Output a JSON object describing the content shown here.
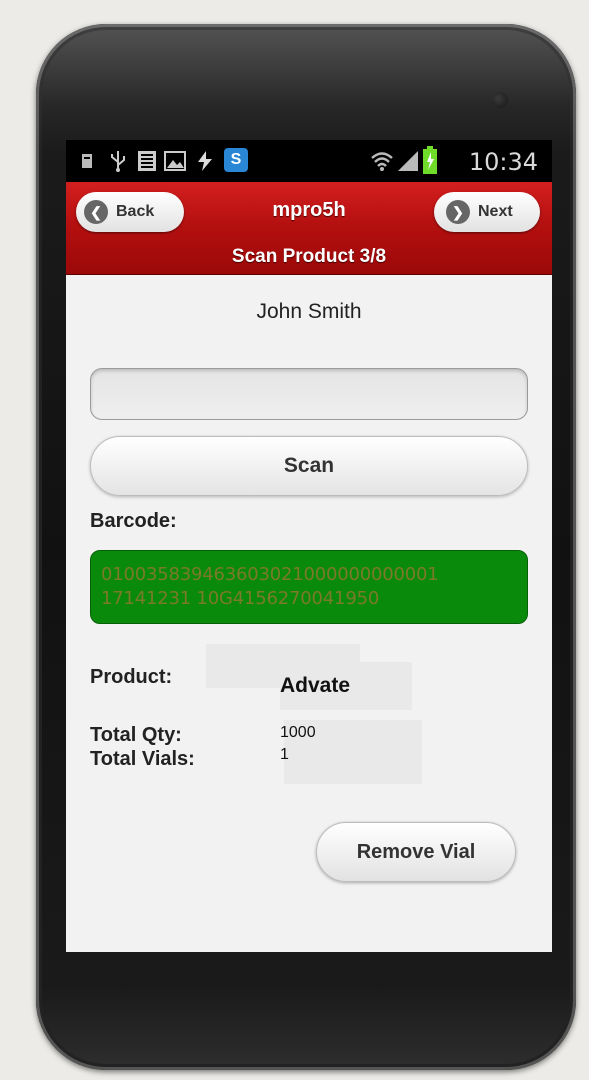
{
  "status_bar": {
    "time": "10:34",
    "left_icons": [
      "notification-icon",
      "usb-icon",
      "sim-icon",
      "image-icon",
      "sync-icon",
      "app-s-icon"
    ],
    "right_icons": [
      "wifi-icon",
      "signal-icon",
      "battery-icon"
    ],
    "app_icon_letter": "S"
  },
  "header": {
    "back_label": "Back",
    "next_label": "Next",
    "title": "mpro5h",
    "subtitle": "Scan Product 3/8",
    "color": "#b51010"
  },
  "main": {
    "user_name": "John Smith",
    "scan_input_value": "",
    "scan_button_label": "Scan",
    "barcode_label": "Barcode:",
    "barcode_line1": "010035839463603021000000000001",
    "barcode_line2": "17141231 10G4156270041950",
    "barcode_bg": "#0a8a0a",
    "product_label": "Product:",
    "product_value": "Advate",
    "total_qty_label": "Total Qty:",
    "total_qty_value": "1000",
    "total_vials_label": "Total Vials:",
    "total_vials_value": "1",
    "remove_button_label": "Remove Vial"
  }
}
